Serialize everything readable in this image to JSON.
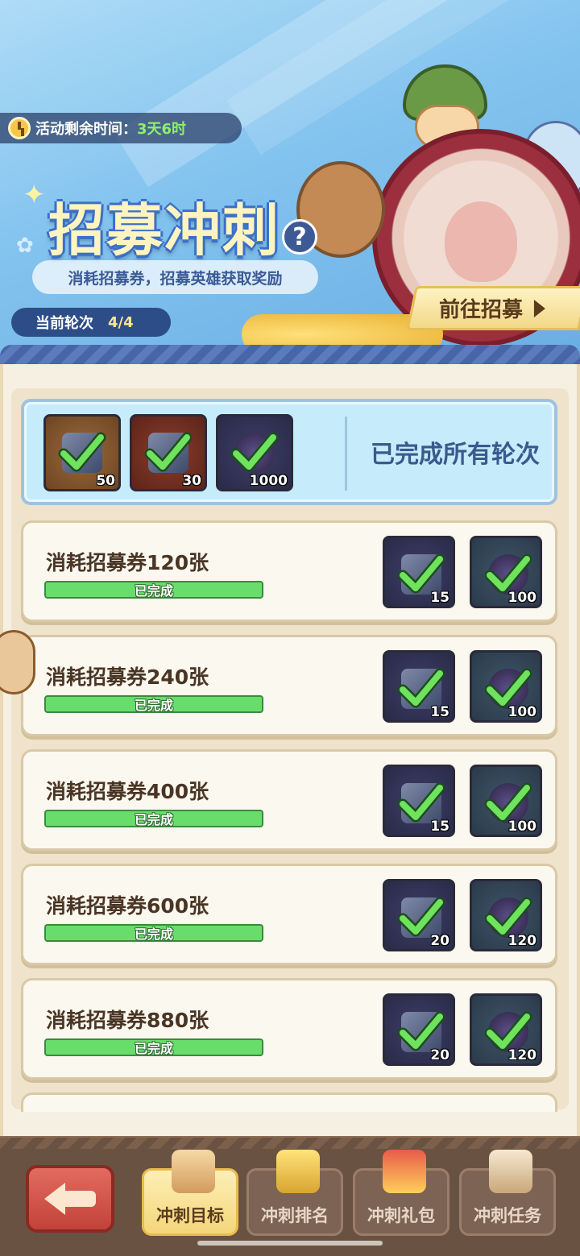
{
  "header": {
    "timer_label": "活动剩余时间：",
    "timer_value": "3天6时",
    "title": "招募冲刺",
    "help_symbol": "?",
    "subtitle": "消耗招募券，招募英雄获取奖励",
    "round_label": "当前轮次",
    "round_value": "4/4",
    "goto_label": "前往招募"
  },
  "summary": {
    "rewards": [
      {
        "icon": "ticket-icon",
        "qty": "50",
        "claimed": true
      },
      {
        "icon": "puzzle-piece-icon",
        "qty": "30",
        "claimed": true
      },
      {
        "icon": "coin-icon",
        "qty": "1000",
        "claimed": true
      }
    ],
    "status": "已完成所有轮次"
  },
  "tasks": [
    {
      "label": "消耗招募券120张",
      "progress_text": "已完成",
      "progress": 1.0,
      "rewards": [
        {
          "icon": "points-book-icon",
          "qty": "15"
        },
        {
          "icon": "orb-icon",
          "qty": "100"
        }
      ]
    },
    {
      "label": "消耗招募券240张",
      "progress_text": "已完成",
      "progress": 1.0,
      "rewards": [
        {
          "icon": "points-book-icon",
          "qty": "15"
        },
        {
          "icon": "orb-icon",
          "qty": "100"
        }
      ]
    },
    {
      "label": "消耗招募券400张",
      "progress_text": "已完成",
      "progress": 1.0,
      "rewards": [
        {
          "icon": "points-book-icon",
          "qty": "15"
        },
        {
          "icon": "orb-icon",
          "qty": "100"
        }
      ]
    },
    {
      "label": "消耗招募券600张",
      "progress_text": "已完成",
      "progress": 1.0,
      "rewards": [
        {
          "icon": "points-book-icon",
          "qty": "20"
        },
        {
          "icon": "orb-icon",
          "qty": "120"
        }
      ]
    },
    {
      "label": "消耗招募券880张",
      "progress_text": "已完成",
      "progress": 1.0,
      "rewards": [
        {
          "icon": "points-book-icon",
          "qty": "20"
        },
        {
          "icon": "orb-icon",
          "qty": "120"
        }
      ]
    }
  ],
  "nav": {
    "tabs": [
      {
        "label": "冲刺目标",
        "icon": "scroll-icon",
        "active": true
      },
      {
        "label": "冲刺排名",
        "icon": "trophy-icon",
        "active": false
      },
      {
        "label": "冲刺礼包",
        "icon": "gift-chest-icon",
        "active": false
      },
      {
        "label": "冲刺任务",
        "icon": "quest-paper-icon",
        "active": false
      }
    ]
  },
  "colors": {
    "banner_blue": "#83c3ef",
    "complete_green": "#69dd6c",
    "summary_bg": "#c6ecfb",
    "nav_brown": "#6a5242",
    "back_red": "#c24238"
  }
}
